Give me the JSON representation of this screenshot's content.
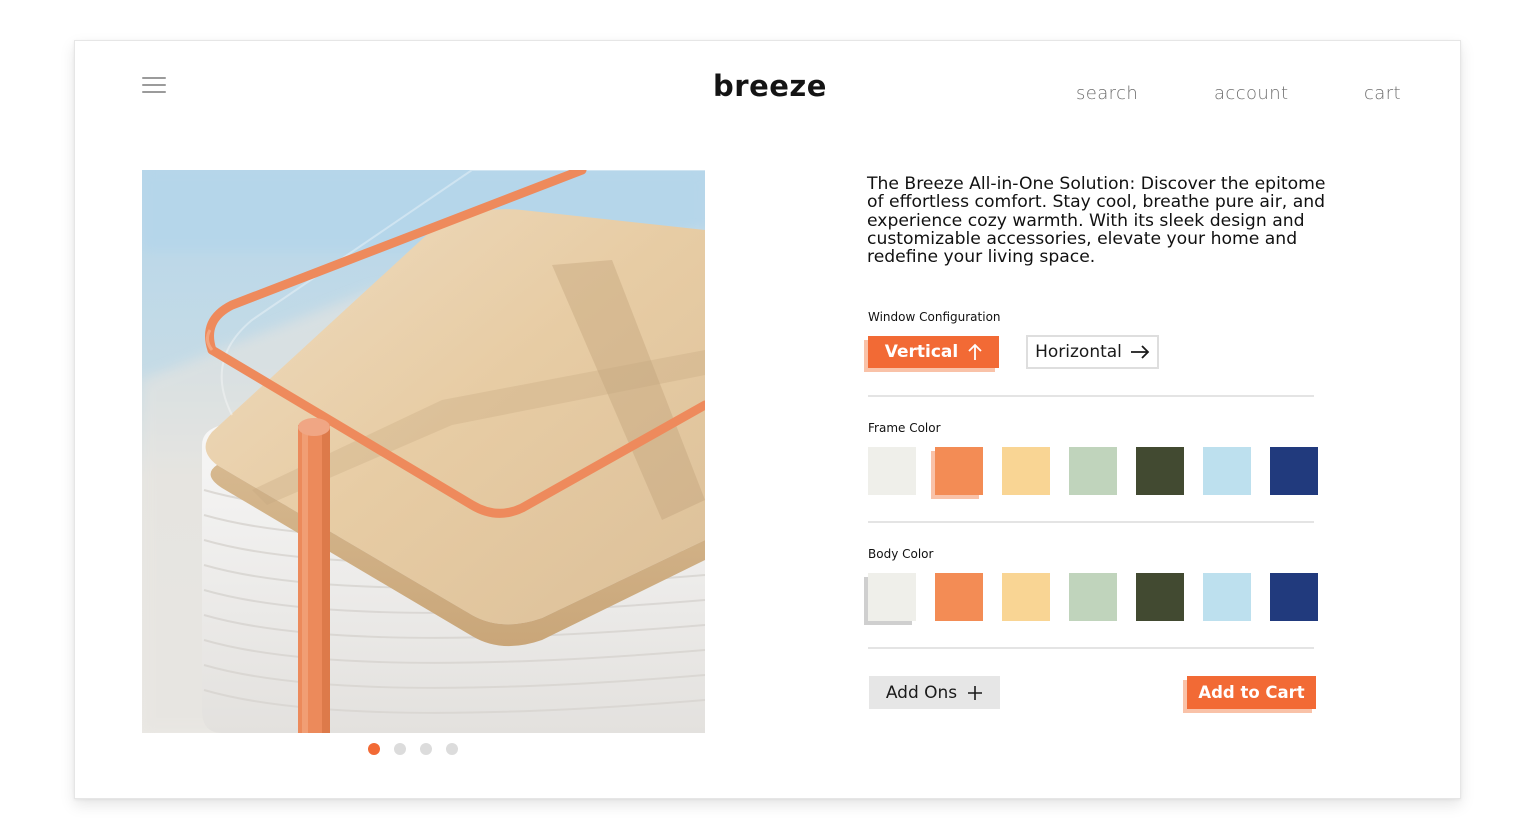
{
  "header": {
    "menu_icon": "hamburger-menu-icon",
    "logo": "breeze",
    "nav": {
      "search": "search",
      "account": "account",
      "cart": "cart"
    }
  },
  "product": {
    "description": "The Breeze All-in-One Solution: Discover the epitome of effortless comfort. Stay cool, breathe pure air, and experience cozy warmth. With its sleek design and customizable accessories, elevate your home and redefine your living space.",
    "gallery": {
      "total_images": 4,
      "active_index": 0
    }
  },
  "window_configuration": {
    "label": "Window Configuration",
    "options": [
      {
        "label": "Vertical",
        "icon": "arrow-up-icon",
        "selected": true
      },
      {
        "label": "Horizontal",
        "icon": "arrow-right-icon",
        "selected": false
      }
    ]
  },
  "frame_color": {
    "label": "Frame Color",
    "selected_index": 1,
    "swatches": [
      "#efefea",
      "#f38c55",
      "#f9d594",
      "#c0d4bc",
      "#424a31",
      "#bde0ee",
      "#213a7d"
    ]
  },
  "body_color": {
    "label": "Body Color",
    "selected_index": 0,
    "swatches": [
      "#efefea",
      "#f38c55",
      "#f9d594",
      "#c0d4bc",
      "#424a31",
      "#bde0ee",
      "#213a7d"
    ]
  },
  "actions": {
    "add_ons": "Add Ons",
    "add_ons_icon": "plus-icon",
    "add_to_cart": "Add to Cart"
  },
  "colors": {
    "accent": "#f26a35",
    "accent_shadow": "#f9c2a8"
  }
}
